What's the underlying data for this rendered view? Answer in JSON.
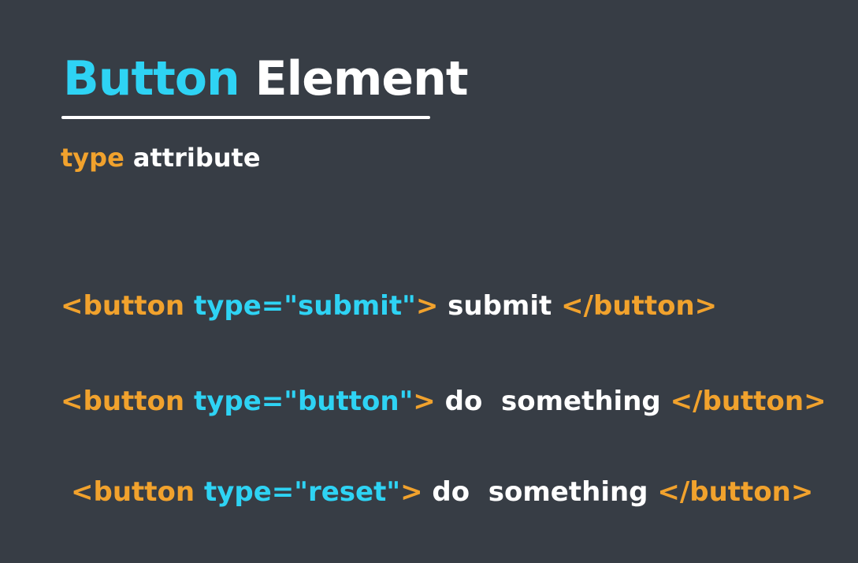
{
  "title": {
    "word1": "Button",
    "word2": "Element"
  },
  "subtitle": {
    "keyword": "type",
    "rest": "attribute"
  },
  "code_lines": [
    {
      "open_tag": "<button",
      "attribute": "type=\"submit\"",
      "open_tag_end": ">",
      "content": "submit",
      "close_tag": "</button>"
    },
    {
      "open_tag": "<button",
      "attribute": "type=\"button\"",
      "open_tag_end": ">",
      "content": "do  something",
      "close_tag": "</button>"
    },
    {
      "open_tag": "<button",
      "attribute": "type=\"reset\"",
      "open_tag_end": ">",
      "content": "do  something",
      "close_tag": "</button>"
    }
  ],
  "colors": {
    "background": "#373d45",
    "accent_blue": "#2ed3f4",
    "accent_orange": "#f1a22d",
    "text_white": "#ffffff"
  }
}
